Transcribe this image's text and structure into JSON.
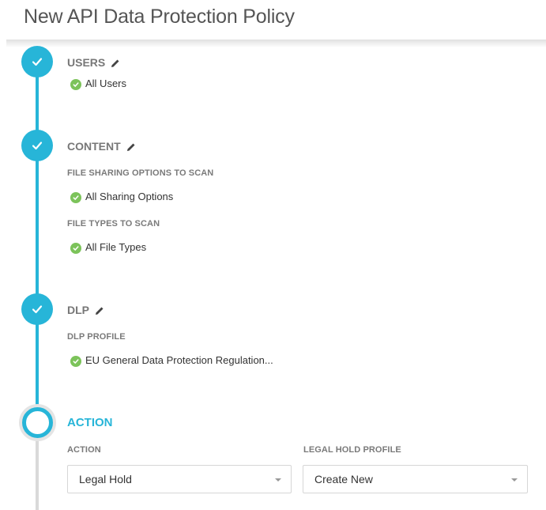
{
  "page": {
    "title": "New API Data Protection Policy"
  },
  "colors": {
    "accent": "#27b5d8",
    "ok": "#7cc35a",
    "pending_line": "#d9d9d9"
  },
  "steps": {
    "users": {
      "heading": "USERS",
      "items": [
        "All Users"
      ]
    },
    "content": {
      "heading": "CONTENT",
      "file_sharing_label": "FILE SHARING OPTIONS TO SCAN",
      "file_sharing_value": "All Sharing Options",
      "file_types_label": "FILE TYPES TO SCAN",
      "file_types_value": "All File Types"
    },
    "dlp": {
      "heading": "DLP",
      "profile_label": "DLP PROFILE",
      "profile_value": "EU General Data Protection Regulation..."
    },
    "action": {
      "heading": "ACTION",
      "action_label": "ACTION",
      "action_value": "Legal Hold",
      "legal_hold_label": "LEGAL HOLD PROFILE",
      "legal_hold_value": "Create New"
    }
  },
  "icons": {
    "done": "check-icon",
    "edit": "pencil-icon",
    "ok": "check-circle-icon",
    "dropdown": "caret-down-icon"
  }
}
